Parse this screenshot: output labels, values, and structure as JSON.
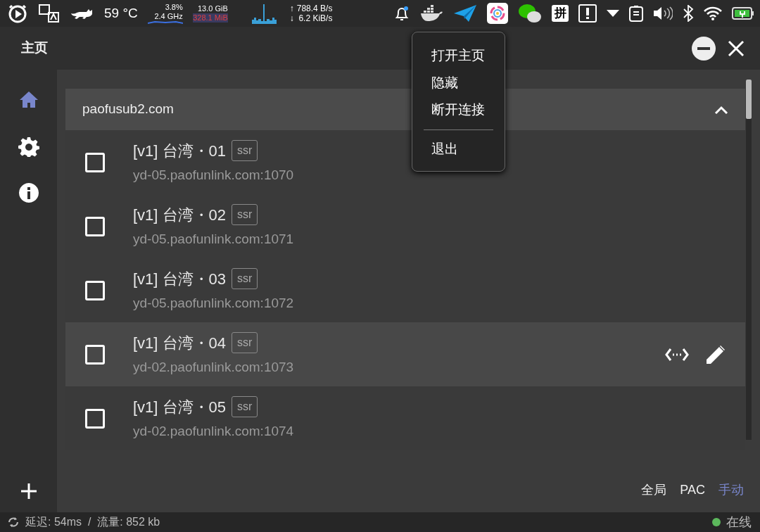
{
  "tray": {
    "temperature": "59 °C",
    "cpu_load": "3.8%",
    "cpu_freq": "2.4 GHz",
    "mem_total": "13.0 GiB",
    "mem_used": "328.1 MiB",
    "net_up_arrow": "↑",
    "net_up": "788.4 B/s",
    "net_down_arrow": "↓",
    "net_down": "6.2 KiB/s",
    "input_method": "拼"
  },
  "header": {
    "title": "主页"
  },
  "sidebar": {
    "items": [
      {
        "kind": "home",
        "selected": true
      },
      {
        "kind": "settings",
        "selected": false
      },
      {
        "kind": "info",
        "selected": false
      }
    ]
  },
  "group": {
    "title": "paofusub2.com",
    "expanded": true
  },
  "servers": [
    {
      "name": "[v1] 台湾・01",
      "tag": "ssr",
      "address": "yd-05.paofunlink.com:1070",
      "checked": false,
      "highlighted": false
    },
    {
      "name": "[v1] 台湾・02",
      "tag": "ssr",
      "address": "yd-05.paofunlink.com:1071",
      "checked": false,
      "highlighted": false
    },
    {
      "name": "[v1] 台湾・03",
      "tag": "ssr",
      "address": "yd-05.paofunlink.com:1072",
      "checked": false,
      "highlighted": false
    },
    {
      "name": "[v1] 台湾・04",
      "tag": "ssr",
      "address": "yd-02.paofunlink.com:1073",
      "checked": false,
      "highlighted": true
    },
    {
      "name": "[v1] 台湾・05",
      "tag": "ssr",
      "address": "yd-02.paofunlink.com:1074",
      "checked": false,
      "highlighted": false
    }
  ],
  "modes": [
    {
      "label": "全局",
      "selected": false
    },
    {
      "label": "PAC",
      "selected": false
    },
    {
      "label": "手动",
      "selected": true
    }
  ],
  "context_menu": {
    "items": [
      {
        "kind": "item",
        "label": "打开主页"
      },
      {
        "kind": "item",
        "label": "隐藏"
      },
      {
        "kind": "item",
        "label": "断开连接"
      },
      {
        "kind": "separator"
      },
      {
        "kind": "item",
        "label": "退出"
      }
    ]
  },
  "status_bar": {
    "stats": "延迟: 54ms  /  流量: 852 kb",
    "online": true,
    "online_label": "在线"
  }
}
